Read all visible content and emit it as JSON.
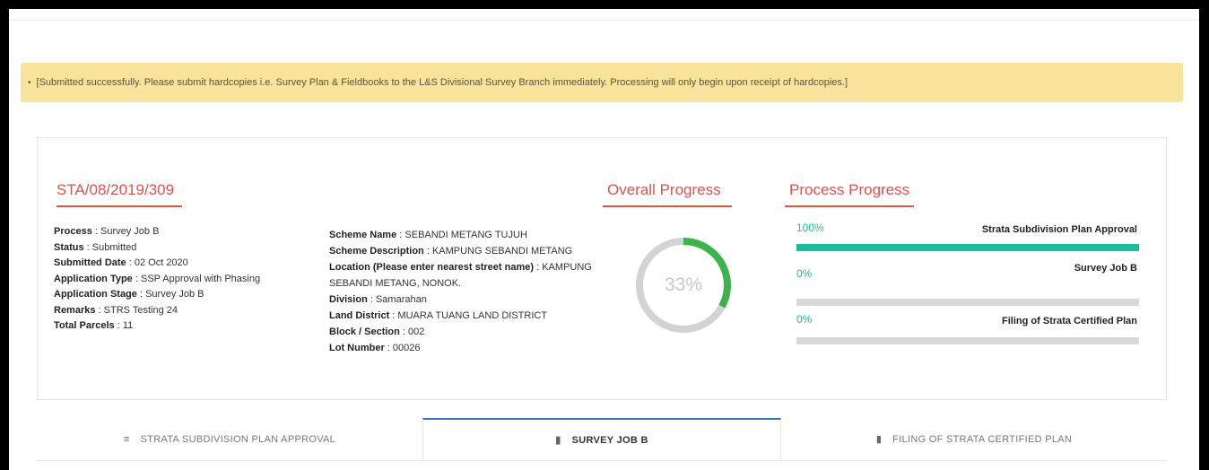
{
  "alert": {
    "bullet": "•",
    "message": "[Submitted successfully. Please submit hardcopies i.e. Survey Plan & Fieldbooks to the L&S Divisional Survey Branch immediately. Processing will only begin upon receipt of hardcopies.]"
  },
  "application": {
    "reference": "STA/08/2019/309",
    "left_fields": [
      {
        "label": "Process",
        "value": "Survey Job B"
      },
      {
        "label": "Status",
        "value": "Submitted"
      },
      {
        "label": "Submitted Date",
        "value": "02 Oct 2020"
      },
      {
        "label": "Application Type",
        "value": "SSP Approval with Phasing"
      },
      {
        "label": "Application Stage",
        "value": "Survey Job B"
      },
      {
        "label": "Remarks",
        "value": "STRS Testing 24"
      },
      {
        "label": "Total Parcels",
        "value": "11"
      }
    ],
    "right_fields": [
      {
        "label": "Scheme Name",
        "value": "SEBANDI METANG TUJUH"
      },
      {
        "label": "Scheme Description",
        "value": "KAMPUNG SEBANDI METANG"
      },
      {
        "label": "Location (Please enter nearest street name)",
        "value": "KAMPUNG SEBANDI METANG, NONOK."
      },
      {
        "label": "Division",
        "value": "Samarahan"
      },
      {
        "label": "Land District",
        "value": "MUARA TUANG LAND DISTRICT"
      },
      {
        "label": "Block / Section",
        "value": "002"
      },
      {
        "label": "Lot Number",
        "value": "00026"
      }
    ]
  },
  "overall_progress": {
    "heading": "Overall Progress",
    "percent_label": "33%",
    "fraction": 0.33,
    "fill_color": "#3cb44b",
    "track_color": "#d3d3d3"
  },
  "process_progress": {
    "heading": "Process Progress",
    "fill_color": "#1abc9c",
    "items": [
      {
        "percent_label": "100%",
        "fraction": 1.0,
        "name": "Strata Subdivision Plan Approval"
      },
      {
        "percent_label": "0%",
        "fraction": 0.0,
        "name": "Survey Job B"
      },
      {
        "percent_label": "0%",
        "fraction": 0.0,
        "name": "Filing of Strata Certified Plan"
      }
    ]
  },
  "tabs": [
    {
      "label": "STRATA SUBDIVISION PLAN APPROVAL",
      "icon": "list-icon",
      "glyph": "≡",
      "active": false
    },
    {
      "label": "SURVEY JOB B",
      "icon": "building-icon",
      "glyph": "▮",
      "active": true
    },
    {
      "label": "FILING OF STRATA CERTIFIED PLAN",
      "icon": "bookmark-icon",
      "glyph": "▮",
      "active": false
    }
  ]
}
